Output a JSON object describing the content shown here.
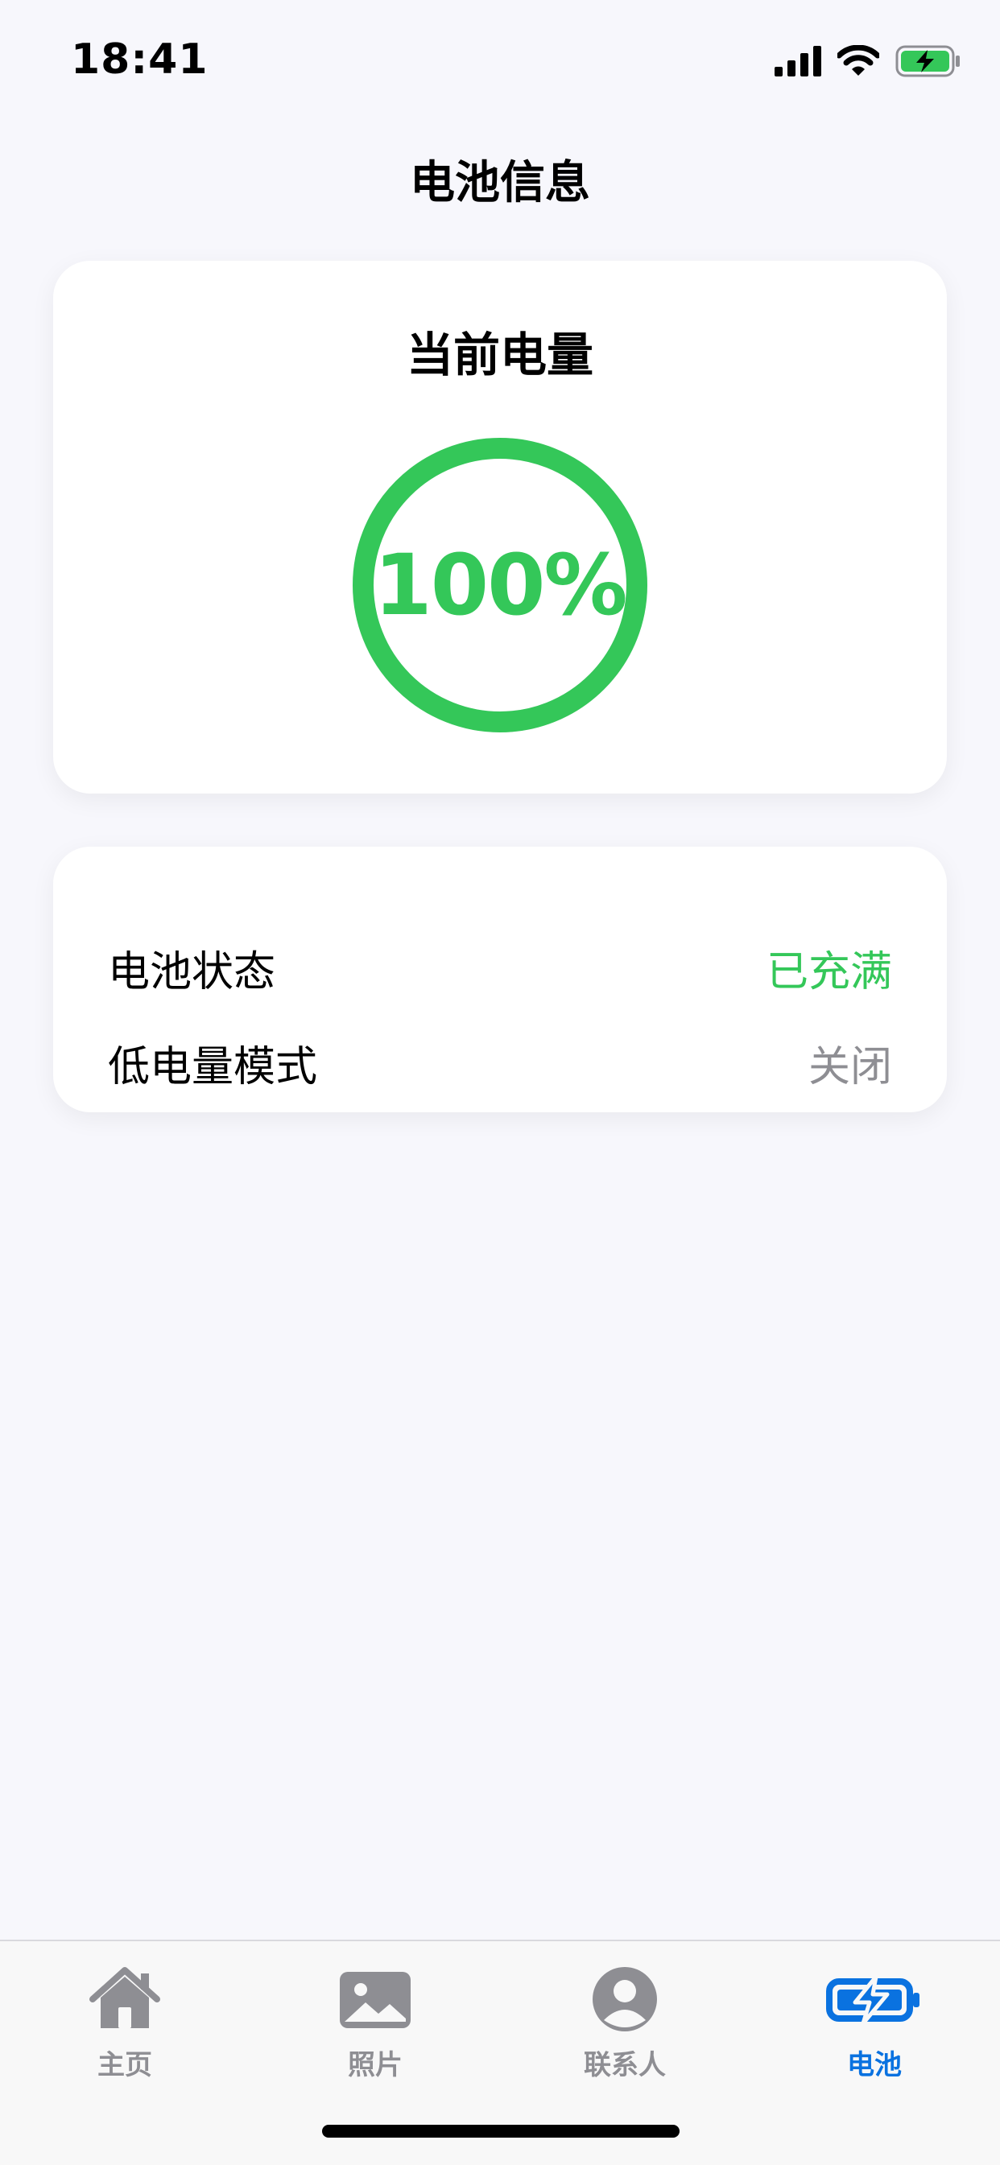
{
  "status_bar": {
    "time": "18:41"
  },
  "header": {
    "title": "电池信息"
  },
  "battery_card": {
    "title": "当前电量",
    "percent_text": "100%",
    "level": 1.0,
    "ring_color": "#34C759"
  },
  "info_card": {
    "rows": [
      {
        "label": "电池状态",
        "value": "已充满",
        "value_color": "#34C759"
      },
      {
        "label": "低电量模式",
        "value": "关闭",
        "value_color": "#8E8E93"
      }
    ]
  },
  "tab_bar": {
    "items": [
      {
        "label": "主页",
        "icon": "house-icon"
      },
      {
        "label": "照片",
        "icon": "photo-icon"
      },
      {
        "label": "联系人",
        "icon": "person-circle-icon"
      },
      {
        "label": "电池",
        "icon": "battery-bolt-icon",
        "selected": true
      }
    ],
    "active_color": "#0A72E0",
    "inactive_color": "#8E8E93"
  }
}
